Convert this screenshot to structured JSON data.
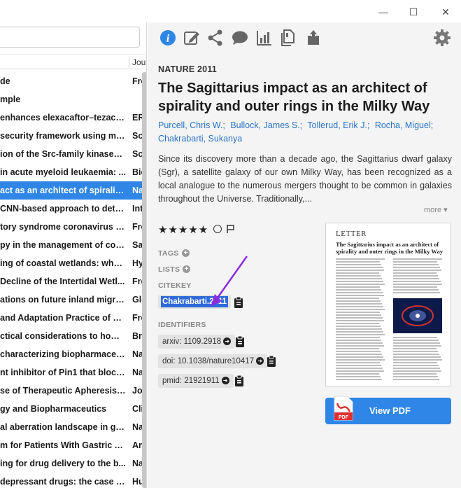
{
  "window": {
    "minimize": "—",
    "maximize": "☐",
    "close": "✕"
  },
  "list": {
    "column_journal": "Jour",
    "rows": [
      {
        "title": "de",
        "journal": "Fro",
        "selected": false
      },
      {
        "title": "mple",
        "journal": "",
        "selected": false
      },
      {
        "title": " enhances elexacaftor–tezacaf...",
        "journal": "ER",
        "selected": false
      },
      {
        "title": "security framework using mul...",
        "journal": "Sci",
        "selected": false
      },
      {
        "title": "ion of the Src-family kinases F...",
        "journal": "Sci",
        "selected": false
      },
      {
        "title": " in acute myeloid leukaemia: ...",
        "journal": "Bio",
        "selected": false
      },
      {
        "title": "act as an architect of spirality ...",
        "journal": "Na",
        "selected": true
      },
      {
        "title": "CNN-based approach to detec...",
        "journal": "Int",
        "selected": false
      },
      {
        "title": "tory syndrome coronavirus in ...",
        "journal": "Fro",
        "selected": false
      },
      {
        "title": "py in the management of coro...",
        "journal": "Sa",
        "selected": false
      },
      {
        "title": "ing of coastal wetlands: what i...",
        "journal": "Hy",
        "selected": false
      },
      {
        "title": "Decline of the Intertidal Wetl...",
        "journal": "Fro",
        "selected": false
      },
      {
        "title": "ations on future inland migrat...",
        "journal": "Glo",
        "selected": false
      },
      {
        "title": "and Adaptation Practice of a ...",
        "journal": "Fro",
        "selected": false
      },
      {
        "title": "ctical considerations to home...",
        "journal": "Bra",
        "selected": false
      },
      {
        "title": "characterizing biopharmaceut...",
        "journal": "Na",
        "selected": false
      },
      {
        "title": "nt inhibitor of Pin1 that block...",
        "journal": "Na",
        "selected": false
      },
      {
        "title": "se of Therapeutic Apheresis in...",
        "journal": "Jou",
        "selected": false
      },
      {
        "title": "gy and Biopharmaceutics",
        "journal": "Cli",
        "selected": false
      },
      {
        "title": "al aberration landscape in gast...",
        "journal": "Na",
        "selected": false
      },
      {
        "title": "m for Patients With Gastric Ad...",
        "journal": "An",
        "selected": false
      },
      {
        "title": "ing for drug delivery to the b...",
        "journal": "Na",
        "selected": false
      },
      {
        "title": "depressant drugs: the case of ...",
        "journal": "Hu",
        "selected": false
      }
    ]
  },
  "detail": {
    "journal_year": "NATURE 2011",
    "title": "The Sagittarius impact as an architect of spirality and outer rings in the Milky Way",
    "authors": [
      "Purcell, Chris W.;",
      "Bullock, James S.;",
      "Tollerud, Erik J.;",
      "Rocha, Miguel;",
      "Chakrabarti, Sukanya"
    ],
    "abstract": "Since its discovery more than a decade ago, the Sagittarius dwarf galaxy (Sgr), a satellite galaxy of our own Milky Way, has been recognized as a local analogue to the numerous mergers thought to be common in galaxies throughout the Universe. Traditionally,...",
    "more": "more",
    "stars": "★★★★★",
    "rating": 5,
    "tags_label": "TAGS",
    "lists_label": "LISTS",
    "citekey_label": "CITEKEY",
    "citekey": "Chakrabarti.2011",
    "identifiers_label": "IDENTIFIERS",
    "identifiers": {
      "arxiv": "arxiv: 1109.2918",
      "doi": "doi: 10.1038/nature10417",
      "pmid": "pmid: 21921911"
    },
    "view_pdf": "View PDF",
    "thumbnail": {
      "section": "LETTER",
      "heading": "The Sagittarius impact as an architect of spirality and outer rings in the Milky Way"
    }
  },
  "colors": {
    "accent": "#2f86e6",
    "highlight": "#2f6ad9",
    "annotation_arrow": "#8a2be2"
  }
}
